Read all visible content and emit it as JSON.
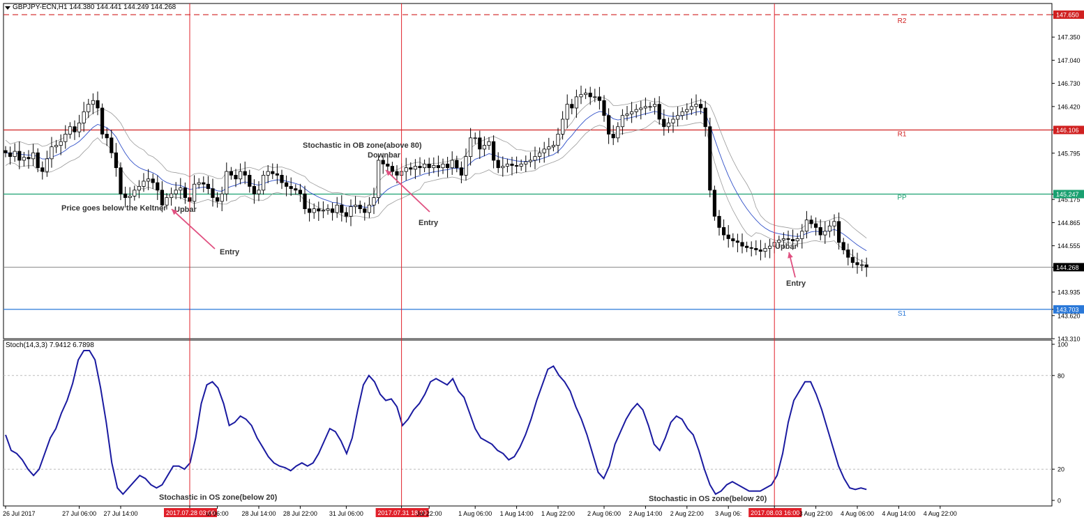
{
  "header": {
    "symbol_info": "GBPJPY-ECN,H1  144.380 144.441 144.249 144.268"
  },
  "stoch_panel": {
    "label": "Stoch(14,3,3) 7.9412 6.7898",
    "scale_labels": [
      "100",
      "80",
      "20",
      "0"
    ]
  },
  "colors": {
    "bull_candle": "#ffffff",
    "bear_candle": "#000000",
    "keltner_mid": "#3050c8",
    "keltner_band": "#9a9a9a",
    "stochastic": "#1a1aa0",
    "marker": "#e0202a",
    "R2": "#d02020",
    "R1": "#d02020",
    "PP": "#1aa070",
    "S1": "#2a78d8",
    "current": "#000000",
    "annotation_arrow": "#e05080"
  },
  "chart_data": {
    "type": "candlestick",
    "title": "",
    "price_axis": {
      "ylim": [
        143.31,
        147.8
      ],
      "tick_labels": [
        "147.650",
        "147.350",
        "147.040",
        "146.730",
        "146.420",
        "146.106",
        "145.795",
        "145.247",
        "145.175",
        "144.865",
        "144.555",
        "144.268",
        "143.935",
        "143.703",
        "143.620",
        "143.310"
      ]
    },
    "time_axis": {
      "tick_labels": [
        {
          "label": "26 Jul 2017",
          "i": 0
        },
        {
          "label": "27 Jul 06:00",
          "i": 16
        },
        {
          "label": "27 Jul 14:00",
          "i": 25
        },
        {
          "label": "2017.07.28 03:00",
          "i": 40,
          "highlight": true
        },
        {
          "label": "ul 06:00",
          "i": 46
        },
        {
          "label": "28 Jul 14:00",
          "i": 55
        },
        {
          "label": "28 Jul 22:00",
          "i": 64
        },
        {
          "label": "31 Jul 06:00",
          "i": 74
        },
        {
          "label": "2017.07.31 18:00",
          "i": 86,
          "highlight": true
        },
        {
          "label": "Jul 22:00",
          "i": 92
        },
        {
          "label": "1 Aug 06:00",
          "i": 102
        },
        {
          "label": "1 Aug 14:00",
          "i": 111
        },
        {
          "label": "1 Aug 22:00",
          "i": 120
        },
        {
          "label": "2 Aug 06:00",
          "i": 130
        },
        {
          "label": "2 Aug 14:00",
          "i": 139
        },
        {
          "label": "2 Aug 22:00",
          "i": 148
        },
        {
          "label": "3 Aug 06:",
          "i": 157
        },
        {
          "label": "2017.08.03 16:00",
          "i": 167,
          "highlight": true
        },
        {
          "label": "3 Aug 22:00",
          "i": 176
        },
        {
          "label": "4 Aug 06:00",
          "i": 185
        },
        {
          "label": "4 Aug 14:00",
          "i": 194
        },
        {
          "label": "4 Aug 22:00",
          "i": 203
        }
      ]
    },
    "pivot_levels": [
      {
        "name": "R2",
        "value": 147.65,
        "label": "147.650",
        "style": "dashed"
      },
      {
        "name": "R1",
        "value": 146.106,
        "label": "146.106",
        "style": "solid"
      },
      {
        "name": "PP",
        "value": 145.247,
        "label": "145.247",
        "style": "solid"
      },
      {
        "name": "S1",
        "value": 143.703,
        "label": "143.703",
        "style": "solid"
      }
    ],
    "current_price": {
      "value": 144.268,
      "label": "144.268"
    },
    "markers": [
      {
        "i": 40,
        "label": "2017.07.28 03:00"
      },
      {
        "i": 86,
        "label": "2017.07.31 18:00"
      },
      {
        "i": 167,
        "label": "2017.08.03 16:00"
      }
    ],
    "closes": [
      145.8,
      145.75,
      145.82,
      145.7,
      145.74,
      145.72,
      145.8,
      145.6,
      145.55,
      145.72,
      145.88,
      145.9,
      145.95,
      146.05,
      146.15,
      146.08,
      146.2,
      146.35,
      146.45,
      146.5,
      146.4,
      146.05,
      146.0,
      145.8,
      145.6,
      145.25,
      145.2,
      145.22,
      145.3,
      145.35,
      145.42,
      145.45,
      145.4,
      145.3,
      145.1,
      145.2,
      145.25,
      145.3,
      145.33,
      145.2,
      145.15,
      145.38,
      145.4,
      145.38,
      145.32,
      145.2,
      145.15,
      145.25,
      145.55,
      145.5,
      145.45,
      145.55,
      145.5,
      145.35,
      145.25,
      145.3,
      145.5,
      145.55,
      145.52,
      145.5,
      145.4,
      145.35,
      145.32,
      145.3,
      145.25,
      145.05,
      145.0,
      145.05,
      145.02,
      145.03,
      145.05,
      145.0,
      145.1,
      145.0,
      144.95,
      145.08,
      145.1,
      145.05,
      145.0,
      145.1,
      145.2,
      145.7,
      145.65,
      145.62,
      145.55,
      145.5,
      145.55,
      145.6,
      145.58,
      145.62,
      145.6,
      145.65,
      145.6,
      145.63,
      145.6,
      145.65,
      145.6,
      145.7,
      145.6,
      145.5,
      145.75,
      146.0,
      146.0,
      145.85,
      145.9,
      145.95,
      145.7,
      145.6,
      145.62,
      145.65,
      145.63,
      145.62,
      145.65,
      145.68,
      145.7,
      145.75,
      145.8,
      145.85,
      145.88,
      145.9,
      146.05,
      146.25,
      146.45,
      146.4,
      146.55,
      146.58,
      146.6,
      146.55,
      146.55,
      146.5,
      146.3,
      146.05,
      146.0,
      146.15,
      146.3,
      146.32,
      146.35,
      146.38,
      146.4,
      146.42,
      146.42,
      146.45,
      146.25,
      146.15,
      146.2,
      146.25,
      146.3,
      146.35,
      146.38,
      146.42,
      146.45,
      146.4,
      146.15,
      145.3,
      144.95,
      144.8,
      144.7,
      144.65,
      144.62,
      144.6,
      144.55,
      144.53,
      144.52,
      144.5,
      144.48,
      144.52,
      144.55,
      144.6,
      144.63,
      144.65,
      144.64,
      144.62,
      144.65,
      144.75,
      144.9,
      144.85,
      144.8,
      144.7,
      144.75,
      144.82,
      144.88,
      144.6,
      144.5,
      144.4,
      144.33,
      144.3,
      144.3,
      144.27
    ],
    "stochastic": {
      "name": "",
      "levels": [
        80,
        20
      ],
      "ylim": [
        0,
        100
      ],
      "values": [
        42,
        32,
        30,
        26,
        20,
        16,
        20,
        30,
        40,
        46,
        56,
        64,
        75,
        90,
        96,
        96,
        90,
        72,
        50,
        24,
        8,
        4,
        8,
        12,
        16,
        14,
        10,
        8,
        10,
        16,
        22,
        22,
        20,
        24,
        40,
        62,
        74,
        76,
        72,
        62,
        48,
        50,
        54,
        52,
        48,
        40,
        34,
        28,
        24,
        22,
        21,
        19,
        22,
        24,
        22,
        24,
        30,
        38,
        46,
        44,
        38,
        30,
        40,
        58,
        74,
        80,
        76,
        68,
        64,
        65,
        60,
        48,
        52,
        58,
        62,
        68,
        76,
        78,
        76,
        74,
        78,
        70,
        66,
        56,
        46,
        40,
        38,
        36,
        32,
        30,
        26,
        28,
        34,
        42,
        52,
        64,
        74,
        84,
        86,
        80,
        76,
        70,
        60,
        52,
        42,
        30,
        18,
        14,
        22,
        36,
        44,
        52,
        58,
        62,
        58,
        48,
        36,
        32,
        40,
        50,
        54,
        52,
        46,
        42,
        32,
        20,
        10,
        4,
        6,
        10,
        12,
        10,
        8,
        6,
        6,
        6,
        8,
        10,
        16,
        30,
        50,
        64,
        70,
        76,
        76,
        68,
        58,
        46,
        34,
        22,
        14,
        8,
        7,
        8,
        7
      ]
    },
    "annotations": [
      {
        "text": "Price goes below the Keltner"
      },
      {
        "text": "Upbar"
      },
      {
        "text": "Entry"
      },
      {
        "text": "Stochastic in OB zone(above 80)"
      },
      {
        "text": "Downbar"
      },
      {
        "text": "Entry"
      },
      {
        "text": "Upbar"
      },
      {
        "text": "Entry"
      },
      {
        "text": "Stochastic in OS zone(below 20)"
      },
      {
        "text": "Stochastic in OS zone(below 20)"
      }
    ]
  }
}
